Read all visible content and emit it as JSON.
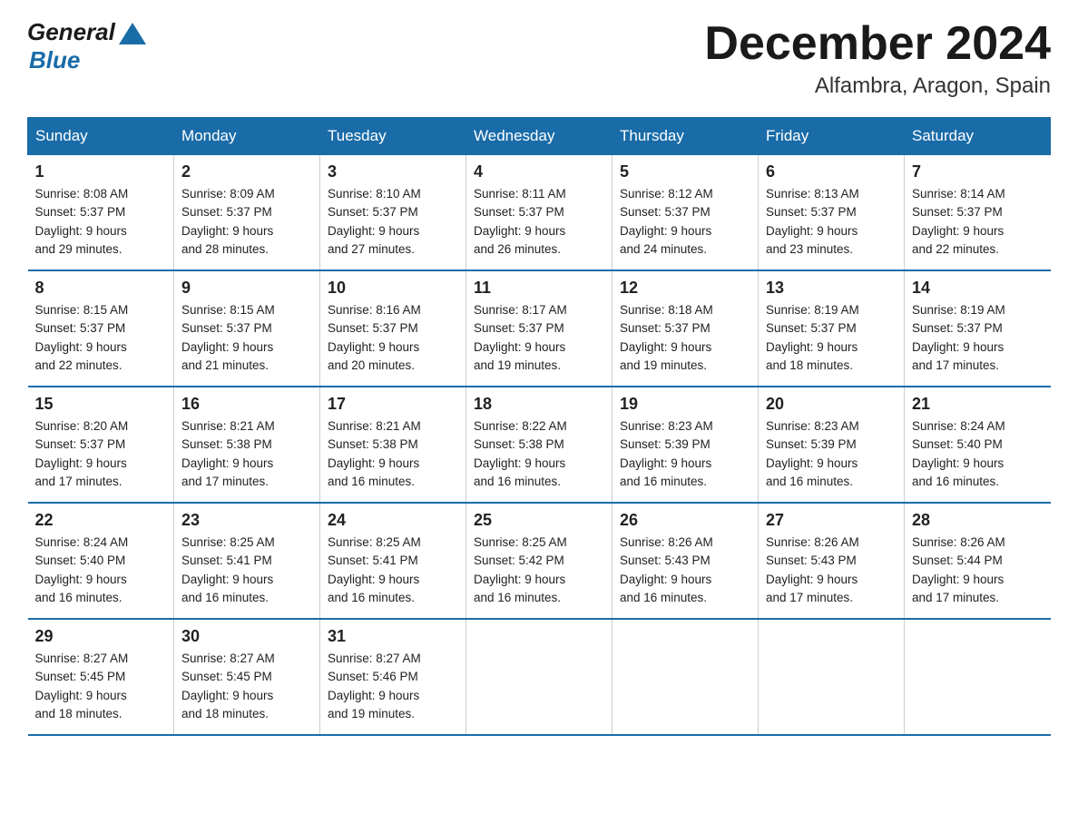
{
  "header": {
    "logo_general": "General",
    "logo_blue": "Blue",
    "month_title": "December 2024",
    "location": "Alfambra, Aragon, Spain"
  },
  "days_of_week": [
    "Sunday",
    "Monday",
    "Tuesday",
    "Wednesday",
    "Thursday",
    "Friday",
    "Saturday"
  ],
  "weeks": [
    [
      {
        "day": "1",
        "sunrise": "8:08 AM",
        "sunset": "5:37 PM",
        "daylight": "9 hours and 29 minutes."
      },
      {
        "day": "2",
        "sunrise": "8:09 AM",
        "sunset": "5:37 PM",
        "daylight": "9 hours and 28 minutes."
      },
      {
        "day": "3",
        "sunrise": "8:10 AM",
        "sunset": "5:37 PM",
        "daylight": "9 hours and 27 minutes."
      },
      {
        "day": "4",
        "sunrise": "8:11 AM",
        "sunset": "5:37 PM",
        "daylight": "9 hours and 26 minutes."
      },
      {
        "day": "5",
        "sunrise": "8:12 AM",
        "sunset": "5:37 PM",
        "daylight": "9 hours and 24 minutes."
      },
      {
        "day": "6",
        "sunrise": "8:13 AM",
        "sunset": "5:37 PM",
        "daylight": "9 hours and 23 minutes."
      },
      {
        "day": "7",
        "sunrise": "8:14 AM",
        "sunset": "5:37 PM",
        "daylight": "9 hours and 22 minutes."
      }
    ],
    [
      {
        "day": "8",
        "sunrise": "8:15 AM",
        "sunset": "5:37 PM",
        "daylight": "9 hours and 22 minutes."
      },
      {
        "day": "9",
        "sunrise": "8:15 AM",
        "sunset": "5:37 PM",
        "daylight": "9 hours and 21 minutes."
      },
      {
        "day": "10",
        "sunrise": "8:16 AM",
        "sunset": "5:37 PM",
        "daylight": "9 hours and 20 minutes."
      },
      {
        "day": "11",
        "sunrise": "8:17 AM",
        "sunset": "5:37 PM",
        "daylight": "9 hours and 19 minutes."
      },
      {
        "day": "12",
        "sunrise": "8:18 AM",
        "sunset": "5:37 PM",
        "daylight": "9 hours and 19 minutes."
      },
      {
        "day": "13",
        "sunrise": "8:19 AM",
        "sunset": "5:37 PM",
        "daylight": "9 hours and 18 minutes."
      },
      {
        "day": "14",
        "sunrise": "8:19 AM",
        "sunset": "5:37 PM",
        "daylight": "9 hours and 17 minutes."
      }
    ],
    [
      {
        "day": "15",
        "sunrise": "8:20 AM",
        "sunset": "5:37 PM",
        "daylight": "9 hours and 17 minutes."
      },
      {
        "day": "16",
        "sunrise": "8:21 AM",
        "sunset": "5:38 PM",
        "daylight": "9 hours and 17 minutes."
      },
      {
        "day": "17",
        "sunrise": "8:21 AM",
        "sunset": "5:38 PM",
        "daylight": "9 hours and 16 minutes."
      },
      {
        "day": "18",
        "sunrise": "8:22 AM",
        "sunset": "5:38 PM",
        "daylight": "9 hours and 16 minutes."
      },
      {
        "day": "19",
        "sunrise": "8:23 AM",
        "sunset": "5:39 PM",
        "daylight": "9 hours and 16 minutes."
      },
      {
        "day": "20",
        "sunrise": "8:23 AM",
        "sunset": "5:39 PM",
        "daylight": "9 hours and 16 minutes."
      },
      {
        "day": "21",
        "sunrise": "8:24 AM",
        "sunset": "5:40 PM",
        "daylight": "9 hours and 16 minutes."
      }
    ],
    [
      {
        "day": "22",
        "sunrise": "8:24 AM",
        "sunset": "5:40 PM",
        "daylight": "9 hours and 16 minutes."
      },
      {
        "day": "23",
        "sunrise": "8:25 AM",
        "sunset": "5:41 PM",
        "daylight": "9 hours and 16 minutes."
      },
      {
        "day": "24",
        "sunrise": "8:25 AM",
        "sunset": "5:41 PM",
        "daylight": "9 hours and 16 minutes."
      },
      {
        "day": "25",
        "sunrise": "8:25 AM",
        "sunset": "5:42 PM",
        "daylight": "9 hours and 16 minutes."
      },
      {
        "day": "26",
        "sunrise": "8:26 AM",
        "sunset": "5:43 PM",
        "daylight": "9 hours and 16 minutes."
      },
      {
        "day": "27",
        "sunrise": "8:26 AM",
        "sunset": "5:43 PM",
        "daylight": "9 hours and 17 minutes."
      },
      {
        "day": "28",
        "sunrise": "8:26 AM",
        "sunset": "5:44 PM",
        "daylight": "9 hours and 17 minutes."
      }
    ],
    [
      {
        "day": "29",
        "sunrise": "8:27 AM",
        "sunset": "5:45 PM",
        "daylight": "9 hours and 18 minutes."
      },
      {
        "day": "30",
        "sunrise": "8:27 AM",
        "sunset": "5:45 PM",
        "daylight": "9 hours and 18 minutes."
      },
      {
        "day": "31",
        "sunrise": "8:27 AM",
        "sunset": "5:46 PM",
        "daylight": "9 hours and 19 minutes."
      },
      null,
      null,
      null,
      null
    ]
  ],
  "labels": {
    "sunrise": "Sunrise:",
    "sunset": "Sunset:",
    "daylight": "Daylight:"
  }
}
